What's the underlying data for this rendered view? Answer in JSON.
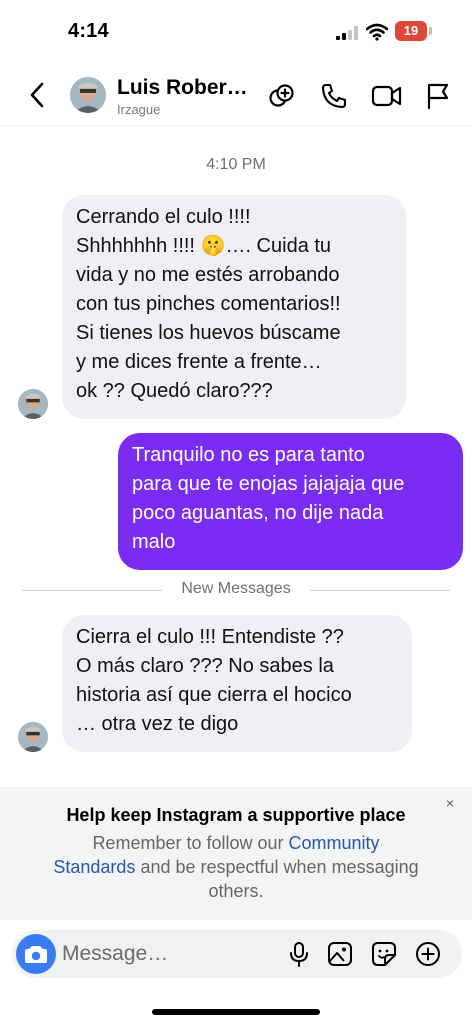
{
  "status": {
    "time": "4:14",
    "battery": "19"
  },
  "header": {
    "name": "Luis Rober…",
    "username": "Irzague"
  },
  "chat": {
    "timestamp": "4:10 PM",
    "messages": [
      {
        "lines": [
          "Cerrando el culo !!!!",
          "Shhhhhhh !!!! 🤫…. Cuida tu",
          "vida y no me estés arrobando",
          "con tus pinches comentarios!!",
          "Si tienes los huevos búscame",
          "y me dices frente a frente…",
          "ok ?? Quedó claro???"
        ]
      },
      {
        "lines": [
          "Tranquilo no es para tanto",
          "para que te enojas jajajaja que",
          "poco aguantas, no dije nada",
          "malo"
        ]
      },
      {
        "lines": [
          "Cierra el culo !!! Entendiste ??",
          "O más claro ??? No sabes la",
          "historia así que cierra el hocico",
          "… otra vez te digo"
        ]
      }
    ],
    "new_messages_label": "New Messages"
  },
  "notice": {
    "title": "Help keep Instagram a supportive place",
    "text_before": "Remember to follow our ",
    "link_part1": "Community",
    "link_part2": "Standards",
    "text_after": " and be respectful when messaging others.",
    "close": "×"
  },
  "composer": {
    "placeholder": "Message…"
  },
  "colors": {
    "outgoing_bubble": "#7a2cf2",
    "incoming_bubble": "#eef0f4",
    "camera_button": "#3a7bf3",
    "link": "#2a55a8"
  }
}
